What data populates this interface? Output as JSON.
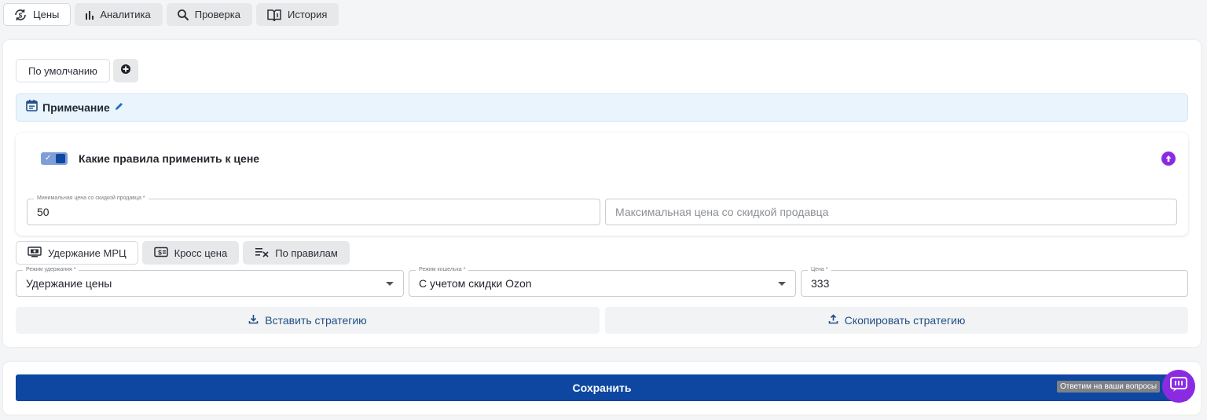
{
  "tabs": [
    {
      "label": "Цены",
      "icon": "price-sync-icon",
      "active": true
    },
    {
      "label": "Аналитика",
      "icon": "bar-chart-icon",
      "active": false
    },
    {
      "label": "Проверка",
      "icon": "search-icon",
      "active": false
    },
    {
      "label": "История",
      "icon": "book-icon",
      "active": false
    }
  ],
  "profile": {
    "default_label": "По умолчанию",
    "add_icon": "plus-circle-icon"
  },
  "note": {
    "title": "Примечание",
    "icon": "calendar-icon",
    "edit_icon": "pencil-icon"
  },
  "rules": {
    "title": "Какие правила применить к цене",
    "toggle_on": true,
    "collapse_icon": "arrow-up-circle-icon",
    "min_price": {
      "label": "Минимальная цена со скидкой продавца *",
      "value": "50"
    },
    "max_price": {
      "placeholder": "Максимальная цена со скидкой продавца",
      "value": ""
    }
  },
  "modes": [
    {
      "label": "Удержание МРЦ",
      "icon": "screen-money-icon",
      "active": true
    },
    {
      "label": "Кросс цена",
      "icon": "cash-icon",
      "active": false
    },
    {
      "label": "По правилам",
      "icon": "list-rules-icon",
      "active": false
    }
  ],
  "settings": {
    "hold_mode": {
      "label": "Режим удержания *",
      "value": "Удержание цены"
    },
    "wallet_mode": {
      "label": "Режим кошелька *",
      "value": "С учетом скидки Ozon"
    },
    "price": {
      "label": "Цена *",
      "value": "333"
    }
  },
  "actions": {
    "paste": "Вставить стратегию",
    "copy": "Скопировать стратегию"
  },
  "save": {
    "label": "Сохранить"
  },
  "help": {
    "label": "Ответим на ваши вопросы",
    "icon": "chat-icon"
  },
  "colors": {
    "primary": "#0d47a1",
    "accent": "#8a2be2",
    "note_bg": "#eaf4fc"
  }
}
